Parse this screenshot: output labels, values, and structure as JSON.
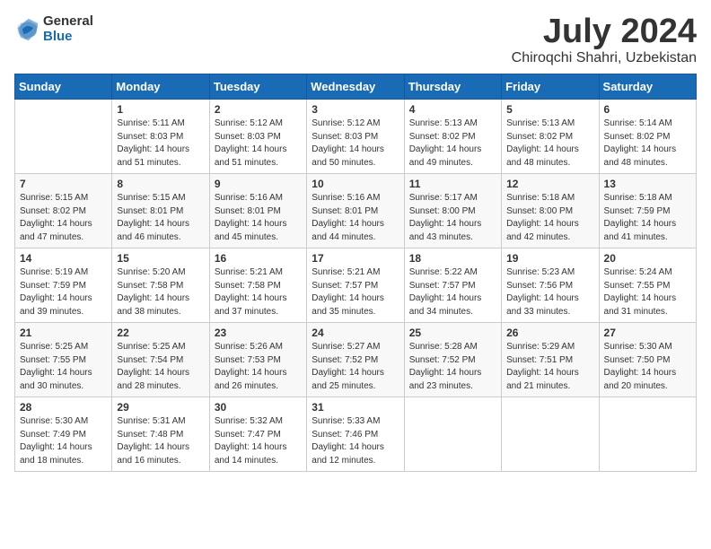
{
  "header": {
    "logo": {
      "general": "General",
      "blue": "Blue"
    },
    "title": "July 2024",
    "subtitle": "Chiroqchi Shahri, Uzbekistan"
  },
  "weekdays": [
    "Sunday",
    "Monday",
    "Tuesday",
    "Wednesday",
    "Thursday",
    "Friday",
    "Saturday"
  ],
  "weeks": [
    [
      {
        "day": null,
        "info": null
      },
      {
        "day": "1",
        "sunrise": "5:11 AM",
        "sunset": "8:03 PM",
        "daylight": "14 hours and 51 minutes."
      },
      {
        "day": "2",
        "sunrise": "5:12 AM",
        "sunset": "8:03 PM",
        "daylight": "14 hours and 51 minutes."
      },
      {
        "day": "3",
        "sunrise": "5:12 AM",
        "sunset": "8:03 PM",
        "daylight": "14 hours and 50 minutes."
      },
      {
        "day": "4",
        "sunrise": "5:13 AM",
        "sunset": "8:02 PM",
        "daylight": "14 hours and 49 minutes."
      },
      {
        "day": "5",
        "sunrise": "5:13 AM",
        "sunset": "8:02 PM",
        "daylight": "14 hours and 48 minutes."
      },
      {
        "day": "6",
        "sunrise": "5:14 AM",
        "sunset": "8:02 PM",
        "daylight": "14 hours and 48 minutes."
      }
    ],
    [
      {
        "day": "7",
        "sunrise": "5:15 AM",
        "sunset": "8:02 PM",
        "daylight": "14 hours and 47 minutes."
      },
      {
        "day": "8",
        "sunrise": "5:15 AM",
        "sunset": "8:01 PM",
        "daylight": "14 hours and 46 minutes."
      },
      {
        "day": "9",
        "sunrise": "5:16 AM",
        "sunset": "8:01 PM",
        "daylight": "14 hours and 45 minutes."
      },
      {
        "day": "10",
        "sunrise": "5:16 AM",
        "sunset": "8:01 PM",
        "daylight": "14 hours and 44 minutes."
      },
      {
        "day": "11",
        "sunrise": "5:17 AM",
        "sunset": "8:00 PM",
        "daylight": "14 hours and 43 minutes."
      },
      {
        "day": "12",
        "sunrise": "5:18 AM",
        "sunset": "8:00 PM",
        "daylight": "14 hours and 42 minutes."
      },
      {
        "day": "13",
        "sunrise": "5:18 AM",
        "sunset": "7:59 PM",
        "daylight": "14 hours and 41 minutes."
      }
    ],
    [
      {
        "day": "14",
        "sunrise": "5:19 AM",
        "sunset": "7:59 PM",
        "daylight": "14 hours and 39 minutes."
      },
      {
        "day": "15",
        "sunrise": "5:20 AM",
        "sunset": "7:58 PM",
        "daylight": "14 hours and 38 minutes."
      },
      {
        "day": "16",
        "sunrise": "5:21 AM",
        "sunset": "7:58 PM",
        "daylight": "14 hours and 37 minutes."
      },
      {
        "day": "17",
        "sunrise": "5:21 AM",
        "sunset": "7:57 PM",
        "daylight": "14 hours and 35 minutes."
      },
      {
        "day": "18",
        "sunrise": "5:22 AM",
        "sunset": "7:57 PM",
        "daylight": "14 hours and 34 minutes."
      },
      {
        "day": "19",
        "sunrise": "5:23 AM",
        "sunset": "7:56 PM",
        "daylight": "14 hours and 33 minutes."
      },
      {
        "day": "20",
        "sunrise": "5:24 AM",
        "sunset": "7:55 PM",
        "daylight": "14 hours and 31 minutes."
      }
    ],
    [
      {
        "day": "21",
        "sunrise": "5:25 AM",
        "sunset": "7:55 PM",
        "daylight": "14 hours and 30 minutes."
      },
      {
        "day": "22",
        "sunrise": "5:25 AM",
        "sunset": "7:54 PM",
        "daylight": "14 hours and 28 minutes."
      },
      {
        "day": "23",
        "sunrise": "5:26 AM",
        "sunset": "7:53 PM",
        "daylight": "14 hours and 26 minutes."
      },
      {
        "day": "24",
        "sunrise": "5:27 AM",
        "sunset": "7:52 PM",
        "daylight": "14 hours and 25 minutes."
      },
      {
        "day": "25",
        "sunrise": "5:28 AM",
        "sunset": "7:52 PM",
        "daylight": "14 hours and 23 minutes."
      },
      {
        "day": "26",
        "sunrise": "5:29 AM",
        "sunset": "7:51 PM",
        "daylight": "14 hours and 21 minutes."
      },
      {
        "day": "27",
        "sunrise": "5:30 AM",
        "sunset": "7:50 PM",
        "daylight": "14 hours and 20 minutes."
      }
    ],
    [
      {
        "day": "28",
        "sunrise": "5:30 AM",
        "sunset": "7:49 PM",
        "daylight": "14 hours and 18 minutes."
      },
      {
        "day": "29",
        "sunrise": "5:31 AM",
        "sunset": "7:48 PM",
        "daylight": "14 hours and 16 minutes."
      },
      {
        "day": "30",
        "sunrise": "5:32 AM",
        "sunset": "7:47 PM",
        "daylight": "14 hours and 14 minutes."
      },
      {
        "day": "31",
        "sunrise": "5:33 AM",
        "sunset": "7:46 PM",
        "daylight": "14 hours and 12 minutes."
      },
      {
        "day": null,
        "info": null
      },
      {
        "day": null,
        "info": null
      },
      {
        "day": null,
        "info": null
      }
    ]
  ],
  "labels": {
    "sunrise_prefix": "Sunrise: ",
    "sunset_prefix": "Sunset: ",
    "daylight_prefix": "Daylight: "
  }
}
